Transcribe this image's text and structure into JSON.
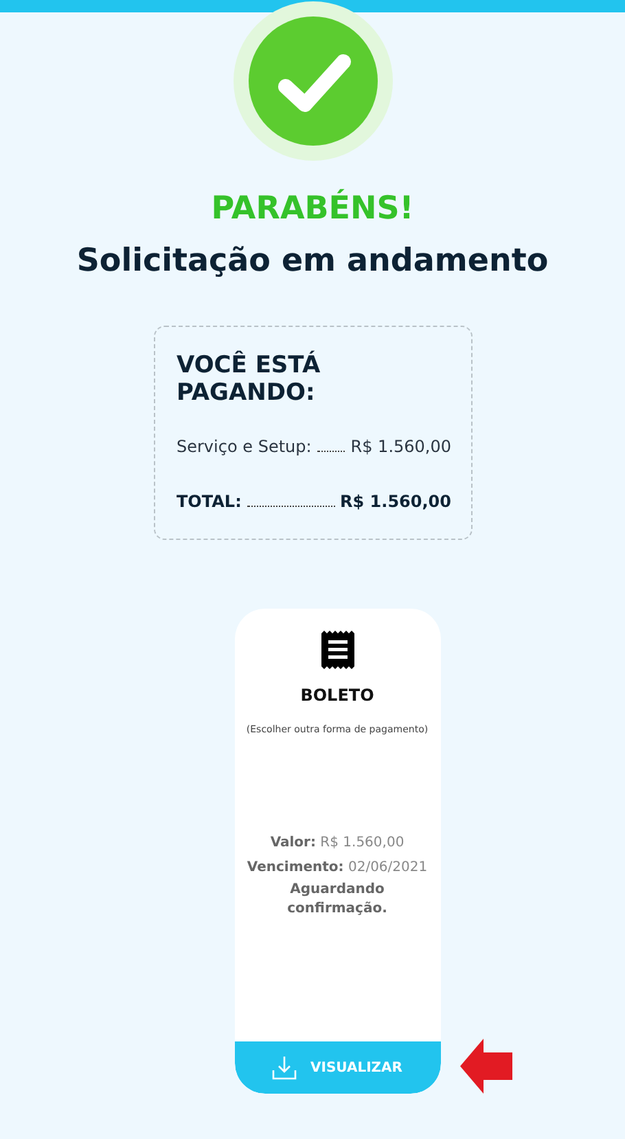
{
  "header": {
    "title": "PARABÉNS!",
    "subtitle": "Solicitação em andamento"
  },
  "summary": {
    "title": "VOCÊ ESTÁ PAGANDO:",
    "lines": [
      {
        "kind": "item",
        "label": "Serviço e Setup:",
        "amount": "R$ 1.560,00"
      },
      {
        "kind": "total",
        "label": "TOTAL:",
        "amount": "R$ 1.560,00"
      }
    ]
  },
  "payment": {
    "method": "BOLETO",
    "change_link": "(Escolher outra forma de pagamento)",
    "details": [
      "**Valor:** R$ 1.560,00",
      "**Vencimento:** 02/06/2021"
    ],
    "status": "Aguardando confirmação.",
    "button": "VISUALIZAR"
  }
}
